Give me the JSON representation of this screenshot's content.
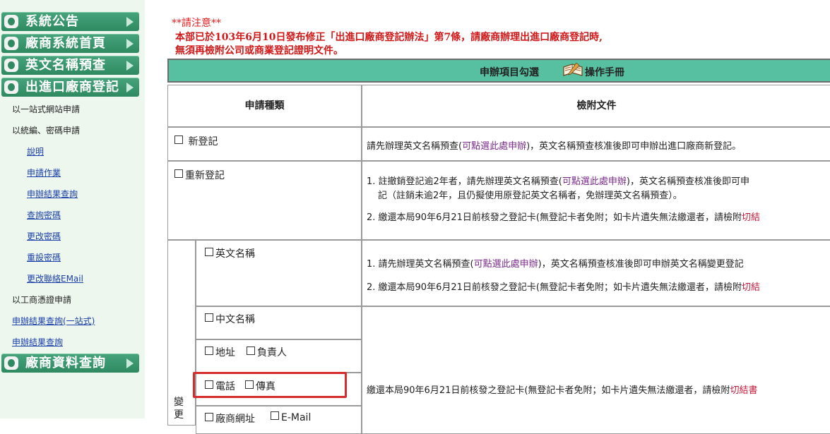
{
  "sidebar": {
    "menu": [
      {
        "label": "系統公告",
        "icon": "bulletin-icon"
      },
      {
        "label": "廠商系統首頁",
        "icon": "home-icon"
      },
      {
        "label": "英文名稱預查",
        "icon": "name-check-icon"
      },
      {
        "label": "出進口廠商登記",
        "icon": "registration-icon"
      },
      {
        "label": "廠商資料查詢",
        "icon": "search-icon"
      }
    ],
    "items": [
      {
        "label": "以一站式網站申請",
        "link": false
      },
      {
        "label": "以統編、密碼申請",
        "link": false
      },
      {
        "label": "說明",
        "link": true
      },
      {
        "label": "申請作業",
        "link": true
      },
      {
        "label": "申辦結果查詢",
        "link": true
      },
      {
        "label": "查詢密碼",
        "link": true
      },
      {
        "label": "更改密碼",
        "link": true
      },
      {
        "label": "重設密碼",
        "link": true
      },
      {
        "label": "更改聯絡EMail",
        "link": true
      },
      {
        "label": "以工商憑證申請",
        "link": false
      },
      {
        "label": "申辦結果查詢(一站式)",
        "link": true
      },
      {
        "label": "申辦結果查詢",
        "link": true
      }
    ]
  },
  "notice": {
    "heading": "**請注意**",
    "line1": "本部已於103年6月10日發布修正「出進口廠商登記辦法」第7條，請廠商辦理出進口廠商登記時,",
    "line2": "無須再檢附公司或商業登記證明文件。"
  },
  "table": {
    "header": "申辦項目勾選",
    "manual": "操作手冊",
    "col_type": "申請種類",
    "col_docs": "檢附文件",
    "new_reg": {
      "label": "新登記",
      "doc_pre": "請先辦理英文名稱預查(",
      "doc_link": "可點選此處申辦",
      "doc_post": ")，英文名稱預查核准後即可申辦出進口廠商新登記。"
    },
    "re_reg": {
      "label": "重新登記",
      "d1_pre": "1. 註撤銷登記逾2年者，請先辦理英文名稱預查(",
      "d1_link": "可點選此處申辦",
      "d1_post": ")，英文名稱預查核准後即可申",
      "d1_line2": "記（註銷未逾2年，且仍擬使用原登記英文名稱者，免辦理英文名稱預查）。",
      "d2_pre": "2. 繳還本局90年6月21日前核發之登記卡(無登記卡者免附；如卡片遺失無法繳還者，請檢附",
      "d2_red": "切結"
    },
    "change_label": "變更",
    "eng_name": {
      "label": "英文名稱",
      "d1_pre": "1. 請先辦理英文名稱預查(",
      "d1_link": "可點選此處申辦",
      "d1_post": ")，英文名稱預查核准後即可申辦英文名稱變更登記",
      "d2_pre": "2. 繳還本局90年6月21日前核發之登記卡(無登記卡者免附；如卡片遺失無法繳還者，請檢附",
      "d2_red": "切結"
    },
    "options": {
      "chinese_name": "中文名稱",
      "address": "地址",
      "responsible": "負責人",
      "phone": "電話",
      "fax": "傳真",
      "website": "廠商網址",
      "email": "E-Mail"
    },
    "other_doc_pre": "繳還本局90年6月21日前核發之登記卡(無登記卡者免附；如卡片遺失無法繳還者，請檢附",
    "other_doc_red": "切結書"
  },
  "colors": {
    "menu_green": "#2f8a61",
    "header_green": "#57c0a0",
    "notice_red": "#d01818",
    "highlight_red": "#d62c2c",
    "link_blue": "#1b3fa8"
  }
}
